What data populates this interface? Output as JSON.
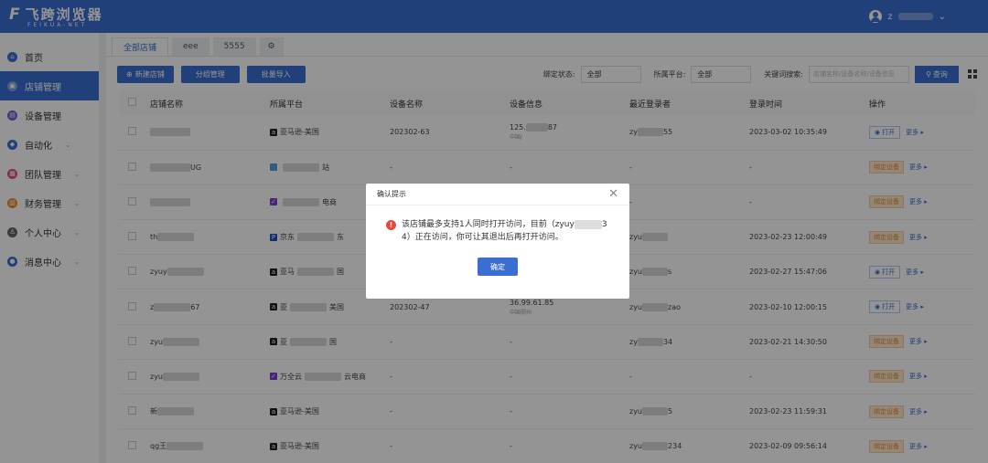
{
  "header": {
    "logo_text": "飞跨浏览器",
    "logo_sub": "FEIKUA-NET",
    "logo_mark": "F",
    "user_prefix": "z",
    "user_chevron": "⌄"
  },
  "sidebar": {
    "items": [
      {
        "label": "首页",
        "icon": "home-icon",
        "color": "#3a6fd1",
        "active": false
      },
      {
        "label": "店铺管理",
        "icon": "store-icon",
        "color": "#ffffff",
        "active": true
      },
      {
        "label": "设备管理",
        "icon": "device-icon",
        "color": "#7b5cd6",
        "active": false
      },
      {
        "label": "自动化",
        "icon": "automation-icon",
        "color": "#3a6fd1",
        "active": false,
        "arrow": true
      },
      {
        "label": "团队管理",
        "icon": "team-icon",
        "color": "#e0508a",
        "active": false,
        "arrow": true
      },
      {
        "label": "财务管理",
        "icon": "finance-icon",
        "color": "#f08c2a",
        "active": false,
        "arrow": true
      },
      {
        "label": "个人中心",
        "icon": "user-center-icon",
        "color": "#666666",
        "active": false,
        "arrow": true
      },
      {
        "label": "消息中心",
        "icon": "message-icon",
        "color": "#3a6fd1",
        "active": false,
        "arrow": true
      }
    ]
  },
  "tabs": [
    {
      "label": "全部店铺",
      "active": true
    },
    {
      "label": "eee",
      "active": false
    },
    {
      "label": "5555",
      "active": false
    }
  ],
  "toolbar": {
    "new_store": "新建店铺",
    "group_manage": "分组管理",
    "batch_import": "批量导入",
    "bind_status_label": "绑定状态:",
    "bind_status_value": "全部",
    "platform_label": "所属平台:",
    "platform_value": "全部",
    "keyword_label": "关键词搜索:",
    "keyword_placeholder": "店铺名称/设备名称/设备信息",
    "search_button": "查询"
  },
  "table": {
    "headers": [
      "店铺名称",
      "所属平台",
      "设备名称",
      "设备信息",
      "最近登录者",
      "登录时间",
      "操作"
    ],
    "rows": [
      {
        "name_pre": "",
        "name_suf": "",
        "platform": "亚马逊-美国",
        "platform_icon": "amazon",
        "device": "202302-63",
        "info": "125.",
        "info_suf": "87",
        "info_sub": "中国/ ",
        "login_pre": "zy",
        "login_suf": "55",
        "time": "2023-03-02 10:35:49",
        "op": "open"
      },
      {
        "name_pre": "",
        "name_suf": "UG",
        "platform": "",
        "platform_suf": "站",
        "platform_icon": "generic",
        "device": "-",
        "info": "-",
        "info_suf": "",
        "info_sub": "",
        "login_pre": "-",
        "login_suf": "",
        "time": "-",
        "op": "bind"
      },
      {
        "name_pre": "",
        "name_suf": "",
        "platform": "",
        "platform_suf": "电商",
        "platform_icon": "purple",
        "device": "-",
        "info": "-",
        "info_suf": "",
        "info_sub": "",
        "login_pre": "-",
        "login_suf": "",
        "time": "-",
        "op": "bind"
      },
      {
        "name_pre": "th",
        "name_suf": "",
        "platform": "京东",
        "platform_suf": "东",
        "platform_icon": "jd",
        "device": "-",
        "info": "-",
        "info_suf": "",
        "info_sub": "",
        "login_pre": "zyu",
        "login_suf": "",
        "time": "2023-02-23 12:00:49",
        "op": "bind"
      },
      {
        "name_pre": "zyuy",
        "name_suf": "",
        "platform": "亚马",
        "platform_suf": "国",
        "platform_icon": "amazon",
        "device": "-",
        "info": "-",
        "info_suf": "",
        "info_sub": "",
        "login_pre": "zyu",
        "login_suf": "s",
        "time": "2023-02-27 15:47:06",
        "op": "open"
      },
      {
        "name_pre": "z",
        "name_suf": "67",
        "platform": "亚",
        "platform_suf": "美国",
        "platform_icon": "amazon",
        "device": "202302-47",
        "info": "36.99.61.85",
        "info_suf": "",
        "info_sub": "中国郑州",
        "login_pre": "zyu",
        "login_suf": "zao",
        "time": "2023-02-10 12:00:15",
        "op": "open"
      },
      {
        "name_pre": "zyu",
        "name_suf": "",
        "platform": "亚",
        "platform_suf": "国",
        "platform_icon": "amazon",
        "device": "-",
        "info": "-",
        "info_suf": "",
        "info_sub": "",
        "login_pre": "zy",
        "login_suf": "34",
        "time": "2023-02-21 14:30:50",
        "op": "bind"
      },
      {
        "name_pre": "zyu",
        "name_suf": "",
        "platform": "万全云",
        "platform_suf": "云电商",
        "platform_icon": "purple",
        "device": "-",
        "info": "-",
        "info_suf": "",
        "info_sub": "",
        "login_pre": "-",
        "login_suf": "",
        "time": "-",
        "op": "bind"
      },
      {
        "name_pre": "新",
        "name_suf": "",
        "platform": "亚马逊-美国",
        "platform_icon": "amazon",
        "device": "-",
        "info": "-",
        "info_suf": "",
        "info_sub": "",
        "login_pre": "zyu",
        "login_suf": "5",
        "time": "2023-02-23 11:59:31",
        "op": "bind"
      },
      {
        "name_pre": "qg王",
        "name_suf": "",
        "platform": "亚马逊-美国",
        "platform_icon": "amazon",
        "device": "-",
        "info": "-",
        "info_suf": "",
        "info_sub": "",
        "login_pre": "zyu",
        "login_suf": "234",
        "time": "2023-02-09 09:56:14",
        "op": "bind"
      }
    ],
    "op_open": "打开",
    "op_bind": "绑定设备",
    "op_more": "更多"
  },
  "modal": {
    "title": "确认提示",
    "message_part1": "该店铺最多支持1人同时打开访问，目前（zyuy",
    "message_part2": "3",
    "message_part3": "4）正在访问，你可让其退出后再打开访问。",
    "confirm": "确定",
    "close": "✕"
  },
  "colors": {
    "brand": "#3a6fd1",
    "warning": "#e04a3c",
    "bind_badge": "#e58a2a"
  }
}
